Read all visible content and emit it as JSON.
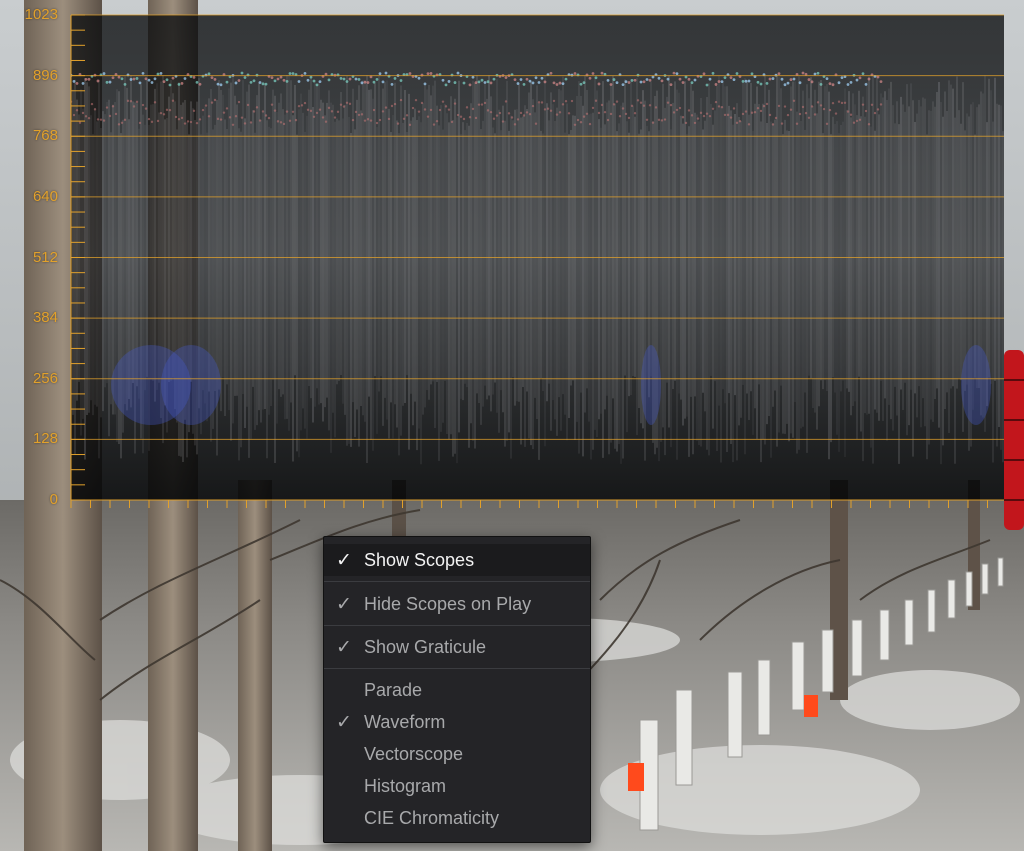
{
  "scope": {
    "type": "Waveform",
    "axis_ticks": [
      "1023",
      "896",
      "768",
      "640",
      "512",
      "384",
      "256",
      "128",
      "0"
    ],
    "graticule_color": "#e2a12b"
  },
  "context_menu": {
    "items": [
      {
        "label": "Show Scopes",
        "checked": true,
        "highlighted": true
      },
      {
        "label": "Hide Scopes on Play",
        "checked": true
      },
      {
        "label": "Show Graticule",
        "checked": true
      },
      {
        "label": "Parade",
        "checked": false
      },
      {
        "label": "Waveform",
        "checked": true
      },
      {
        "label": "Vectorscope",
        "checked": false
      },
      {
        "label": "Histogram",
        "checked": false
      },
      {
        "label": "CIE Chromaticity",
        "checked": false
      }
    ],
    "check_glyph": "✓"
  }
}
